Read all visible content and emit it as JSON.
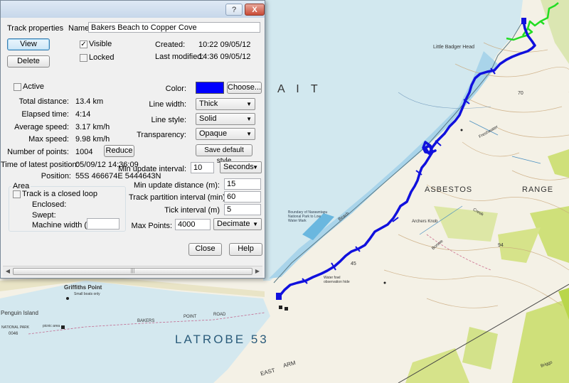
{
  "dialog": {
    "close_glyph": "X",
    "help_glyph": "?",
    "heading": "Track properties",
    "name_label": "Name",
    "name_value": "Bakers Beach to Copper Cove",
    "view_button": "View",
    "delete_button": "Delete",
    "visible_label": "Visible",
    "visible_checked": true,
    "locked_label": "Locked",
    "locked_checked": false,
    "created_label": "Created:",
    "created_value": "10:22 09/05/12",
    "modified_label": "Last modified:",
    "modified_value": "14:36 09/05/12",
    "active_label": "Active",
    "active_checked": false,
    "stats": {
      "total_distance_label": "Total distance:",
      "total_distance_value": "13.4 km",
      "elapsed_label": "Elapsed time:",
      "elapsed_value": "4:14",
      "avg_speed_label": "Average speed:",
      "avg_speed_value": "3.17 km/h",
      "max_speed_label": "Max speed:",
      "max_speed_value": "9.98 km/h",
      "points_label": "Number of points:",
      "points_value": "1004",
      "reduce_button": "Reduce",
      "latest_time_label": "Time of latest position:",
      "latest_time_value": "05/09/12 14:36:09",
      "position_label": "Position:",
      "position_value": "55S 466674E 5444643N"
    },
    "appearance": {
      "color_label": "Color:",
      "color_hex": "#0000ff",
      "choose_button": "Choose...",
      "line_width_label": "Line width:",
      "line_width_value": "Thick",
      "line_style_label": "Line style:",
      "line_style_value": "Solid",
      "transparency_label": "Transparency:",
      "transparency_value": "Opaque",
      "save_default_button": "Save default style"
    },
    "update": {
      "min_interval_label": "Min update interval:",
      "min_interval_value": "10",
      "interval_unit": "Seconds",
      "min_distance_label": "Min update distance (m):",
      "min_distance_value": "15",
      "partition_label": "Track partition interval (min):",
      "partition_value": "60",
      "tick_label": "Tick interval (m)",
      "tick_value": "5",
      "max_points_label": "Max Points:",
      "max_points_value": "4000",
      "max_points_action": "Decimate"
    },
    "area": {
      "group_label": "Area",
      "closed_loop_label": "Track is a closed loop",
      "closed_loop_checked": false,
      "enclosed_label": "Enclosed:",
      "swept_label": "Swept:",
      "machine_width_label": "Machine width (m):",
      "machine_width_value": ""
    },
    "close_button": "Close",
    "help_button": "Help"
  },
  "map": {
    "strait_label": "A I T",
    "place_little_badger": "Little Badger Head",
    "place_asbestos": "ASBESTOS",
    "place_range": "RANGE",
    "place_latrobe": "LATROBE 53",
    "place_griffiths": "Griffiths Point",
    "place_penguin": "Penguin Island",
    "place_archers": "Archers Knob",
    "place_east_arm": "EAST",
    "place_arm": "ARM",
    "place_bakers": "BAKERS",
    "place_point": "POINT",
    "place_road": "ROAD",
    "place_national_park": "NATIONAL PARK",
    "place_beach": "Beach",
    "place_freshwater": "Freshwater",
    "place_creek": "Creek",
    "place_bonnie": "Bonnie",
    "place_briggs": "Briggs",
    "place_water_fowl": "Water fowl observation hide",
    "place_small_boats": "Small boats only",
    "place_picnic_area": "picnic area",
    "place_boundary": "Boundary of Narawntapu National Park to Low Water Mark",
    "elev_70": "70",
    "elev_45": "45",
    "elev_0046": "0046",
    "elev_94": "94",
    "track_color": "#1010dd",
    "second_track_color": "#22dd22"
  }
}
